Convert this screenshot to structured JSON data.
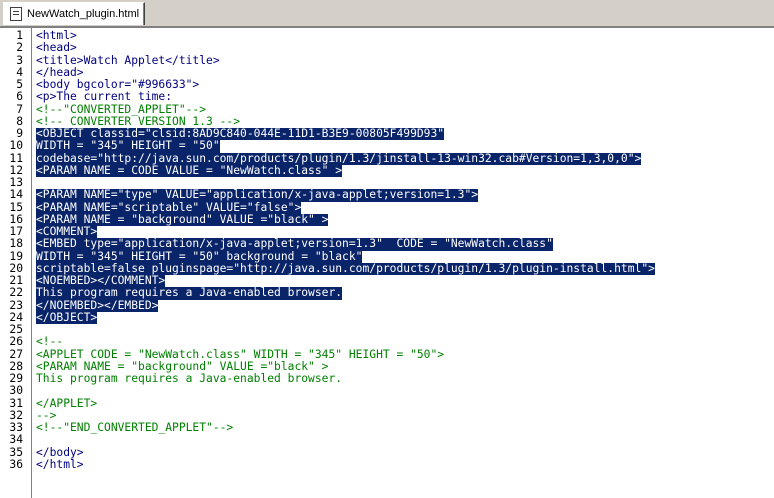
{
  "tab": {
    "label": "NewWatch_plugin.html",
    "icon": "html-file-icon"
  },
  "colors": {
    "code": "#000080",
    "comment": "#008000",
    "selection_bg": "#0a246a",
    "selection_fg": "#ffffff",
    "background": "#ffffff",
    "chrome": "#d4d0c8"
  },
  "lines": [
    {
      "n": "1",
      "text": "<html>"
    },
    {
      "n": "2",
      "text": "<head>"
    },
    {
      "n": "3",
      "text": "<title>Watch Applet</title>"
    },
    {
      "n": "4",
      "text": "</head>"
    },
    {
      "n": "5",
      "text": "<body bgcolor=\"#996633\">"
    },
    {
      "n": "6",
      "text": "<p>The current time:"
    },
    {
      "n": "7",
      "text": "<!--\"CONVERTED_APPLET\"-->",
      "comment": true
    },
    {
      "n": "8",
      "text": "<!-- CONVERTER VERSION 1.3 -->",
      "comment": true
    },
    {
      "n": "9",
      "text": "<OBJECT classid=\"clsid:8AD9C840-044E-11D1-B3E9-00805F499D93\"",
      "selected": true
    },
    {
      "n": "10",
      "text": "WIDTH = \"345\" HEIGHT = \"50\"",
      "selected": true
    },
    {
      "n": "11",
      "text": "codebase=\"http://java.sun.com/products/plugin/1.3/jinstall-13-win32.cab#Version=1,3,0,0\">",
      "selected": true
    },
    {
      "n": "12",
      "text": "<PARAM NAME = CODE VALUE = \"NewWatch.class\" >",
      "selected": true
    },
    {
      "n": "13",
      "text": "",
      "selected": false
    },
    {
      "n": "14",
      "text": "<PARAM NAME=\"type\" VALUE=\"application/x-java-applet;version=1.3\">",
      "selected": true
    },
    {
      "n": "15",
      "text": "<PARAM NAME=\"scriptable\" VALUE=\"false\">",
      "selected": true
    },
    {
      "n": "16",
      "text": "<PARAM NAME = \"background\" VALUE =\"black\" >",
      "selected": true
    },
    {
      "n": "17",
      "text": "<COMMENT>",
      "selected": true
    },
    {
      "n": "18",
      "text": "<EMBED type=\"application/x-java-applet;version=1.3\"  CODE = \"NewWatch.class\"",
      "selected": true
    },
    {
      "n": "19",
      "text": "WIDTH = \"345\" HEIGHT = \"50\" background = \"black\"",
      "selected": true
    },
    {
      "n": "20",
      "text": "scriptable=false pluginspage=\"http://java.sun.com/products/plugin/1.3/plugin-install.html\">",
      "selected": true
    },
    {
      "n": "21",
      "text": "<NOEMBED></COMMENT>",
      "selected": true
    },
    {
      "n": "22",
      "text": "This program requires a Java-enabled browser.",
      "selected": true
    },
    {
      "n": "23",
      "text": "</NOEMBED></EMBED>",
      "selected": true
    },
    {
      "n": "24",
      "text": "</OBJECT>",
      "selected": true
    },
    {
      "n": "25",
      "text": ""
    },
    {
      "n": "26",
      "text": "<!--",
      "comment": true
    },
    {
      "n": "27",
      "text": "<APPLET CODE = \"NewWatch.class\" WIDTH = \"345\" HEIGHT = \"50\">",
      "comment": true
    },
    {
      "n": "28",
      "text": "<PARAM NAME = \"background\" VALUE =\"black\" >",
      "comment": true
    },
    {
      "n": "29",
      "text": "This program requires a Java-enabled browser.",
      "comment": true
    },
    {
      "n": "30",
      "text": ""
    },
    {
      "n": "31",
      "text": "</APPLET>",
      "comment": true
    },
    {
      "n": "32",
      "text": "-->",
      "comment": true
    },
    {
      "n": "33",
      "text": "<!--\"END_CONVERTED_APPLET\"-->",
      "comment": true
    },
    {
      "n": "34",
      "text": ""
    },
    {
      "n": "35",
      "text": "</body>"
    },
    {
      "n": "36",
      "text": "</html>"
    }
  ]
}
